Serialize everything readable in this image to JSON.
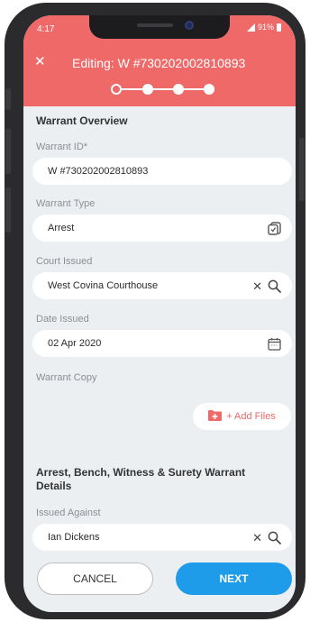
{
  "status_bar": {
    "time": "4:17",
    "battery": "91%"
  },
  "header": {
    "close_icon": "close-icon",
    "title": "Editing: W #730202002810893",
    "steps_total": 4,
    "current_step": 1
  },
  "warrant_overview": {
    "section_title": "Warrant Overview",
    "warrant_id": {
      "label": "Warrant ID*",
      "value": "W #730202002810893"
    },
    "warrant_type": {
      "label": "Warrant Type",
      "value": "Arrest",
      "icon": "select-list-icon"
    },
    "court_issued": {
      "label": "Court Issued",
      "value": "West Covina Courthouse",
      "icons": [
        "clear-icon",
        "search-icon"
      ]
    },
    "date_issued": {
      "label": "Date Issued",
      "value": "02 Apr 2020",
      "icon": "calendar-icon"
    },
    "warrant_copy": {
      "label": "Warrant Copy",
      "add_files_label": "+ Add Files",
      "icon": "add-file-icon"
    }
  },
  "details": {
    "section_title": "Arrest, Bench, Witness & Surety Warrant Details",
    "issued_against": {
      "label": "Issued Against",
      "value": "Ian Dickens",
      "icons": [
        "clear-icon",
        "search-icon"
      ]
    }
  },
  "footer": {
    "cancel_label": "CANCEL",
    "next_label": "NEXT"
  },
  "colors": {
    "header": "#ef6969",
    "accent": "#1e9be9",
    "background": "#eceff1"
  }
}
